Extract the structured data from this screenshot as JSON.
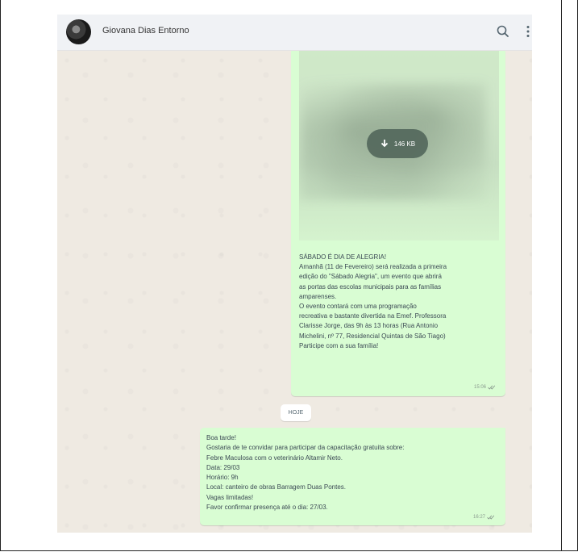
{
  "header": {
    "contact_name": "Giovana Dias Entorno",
    "search_icon": "search-icon",
    "menu_icon": "kebab-menu-icon"
  },
  "messages": [
    {
      "type": "image",
      "direction": "outgoing",
      "download_size": "146 KB",
      "caption_lines": [
        "SÁBADO É DIA DE ALEGRIA!",
        "Amanhã (11 de Fevereiro) será realizada a primeira",
        "edição do \"Sábado Alegria\", um evento que abrirá",
        "as portas das escolas municipais para as famílias",
        "amparenses.",
        "O evento contará com uma programação",
        "recreativa e bastante divertida na Emef. Professora",
        "Clarisse Jorge, das 9h às 13 horas (Rua Antonio",
        "Michelini, nº 77, Residencial Quintas de São Tiago)",
        "Participe com a sua família!"
      ],
      "time": "15:06"
    },
    {
      "type": "text",
      "direction": "outgoing",
      "lines": [
        "Boa tarde!",
        "Gostaria de te convidar para participar da capacitação gratuita sobre:",
        "Febre Maculosa com o veterinário Altamir Neto.",
        "Data: 29/03",
        "Horário: 9h",
        "Local: canteiro de obras Barragem Duas Pontes.",
        "Vagas limitadas!",
        "Favor confirmar presença até o dia: 27/03."
      ],
      "time": "16:27"
    }
  ],
  "day_separator": "HOJE",
  "colors": {
    "outgoing_bubble": "#d9fdd3",
    "chat_background": "#efeae2",
    "header_background": "#f0f2f5"
  }
}
